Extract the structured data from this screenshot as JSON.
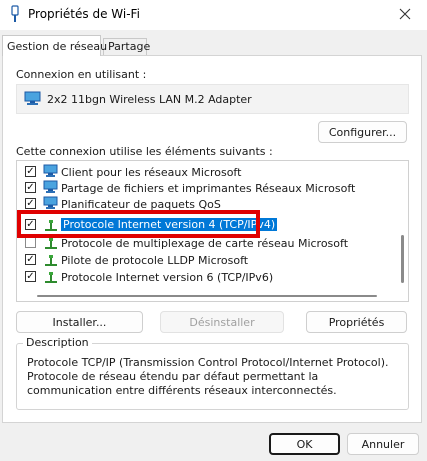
{
  "window": {
    "title": "Propriétés de Wi-Fi",
    "icon": "wifi-adapter-icon",
    "close_icon": "close-icon"
  },
  "tabs": [
    {
      "label": "Gestion de réseau",
      "active": true
    },
    {
      "label": "Partage",
      "active": false
    }
  ],
  "connection": {
    "label": "Connexion en utilisant :",
    "adapter_icon": "network-adapter-icon",
    "adapter_name": "2x2 11bgn Wireless LAN M.2 Adapter",
    "configure_button": "Configurer..."
  },
  "components": {
    "label": "Cette connexion utilise les éléments suivants :",
    "items": [
      {
        "label": "Client pour les réseaux Microsoft",
        "checked": true,
        "icon": "network-client-icon",
        "selected": false
      },
      {
        "label": "Partage de fichiers et imprimantes Réseaux Microsoft",
        "checked": true,
        "icon": "network-service-icon",
        "selected": false
      },
      {
        "label": "Planificateur de paquets QoS",
        "checked": true,
        "icon": "network-service-icon",
        "selected": false
      },
      {
        "label": "Protocole Internet version 4 (TCP/IPv4)",
        "checked": true,
        "icon": "protocol-icon",
        "selected": true
      },
      {
        "label": "Protocole de multiplexage de carte réseau Microsoft",
        "checked": false,
        "icon": "protocol-icon",
        "selected": false
      },
      {
        "label": "Pilote de protocole LLDP Microsoft",
        "checked": true,
        "icon": "protocol-icon",
        "selected": false
      },
      {
        "label": "Protocole Internet version 6 (TCP/IPv6)",
        "checked": true,
        "icon": "protocol-icon",
        "selected": false
      }
    ]
  },
  "buttons": {
    "install": "Installer...",
    "uninstall": "Désinstaller",
    "properties": "Propriétés",
    "ok": "OK",
    "cancel": "Annuler"
  },
  "description": {
    "title": "Description",
    "text": "Protocole TCP/IP (Transmission Control Protocol/Internet Protocol). Protocole de réseau étendu par défaut permettant la communication entre différents réseaux interconnectés."
  },
  "colors": {
    "selection": "#0078d7",
    "annotation": "#e00000"
  }
}
